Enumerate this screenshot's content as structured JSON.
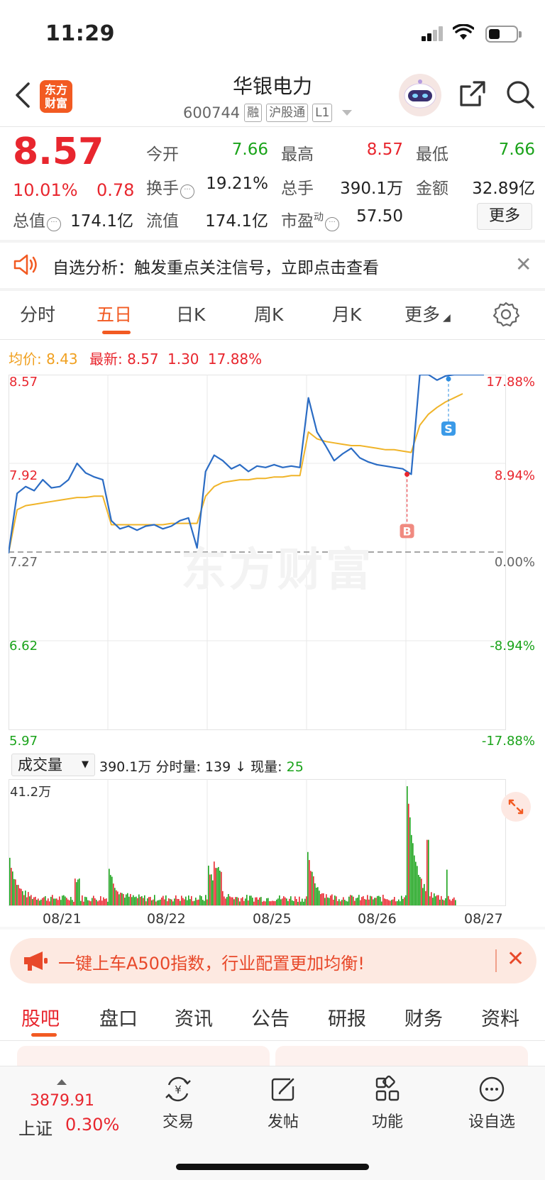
{
  "status_bar": {
    "time": "11:29"
  },
  "header": {
    "logo_line1": "东方",
    "logo_line2": "财富",
    "stock_name": "华银电力",
    "stock_code": "600744",
    "tags": [
      "融",
      "沪股通",
      "L1"
    ]
  },
  "quote": {
    "price": "8.57",
    "change_pct": "10.01%",
    "change": "0.78",
    "open_label": "今开",
    "open": "7.66",
    "high_label": "最高",
    "high": "8.57",
    "low_label": "最低",
    "low": "7.66",
    "turnover_label": "换手",
    "turnover": "19.21%",
    "volume_label": "总手",
    "volume": "390.1万",
    "amount_label": "金额",
    "amount": "32.89亿",
    "mktcap_label": "总值",
    "mktcap": "174.1亿",
    "float_label": "流值",
    "float": "174.1亿",
    "pe_label": "市盈",
    "pe_sup": "动",
    "pe": "57.50",
    "more_label": "更多"
  },
  "alert": {
    "text": "自选分析：触发重点关注信号，立即点击查看"
  },
  "chart_tabs": [
    "分时",
    "五日",
    "日K",
    "周K",
    "月K",
    "更多"
  ],
  "chart_tabs_active": 1,
  "legend": {
    "avg_label": "均价:",
    "avg": "8.43",
    "latest_label": "最新:",
    "latest": "8.57",
    "chg": "1.30",
    "pct": "17.88%"
  },
  "colors": {
    "up": "#e8262e",
    "down": "#1aa31a",
    "price_line": "#2b6cc4",
    "avg_line": "#f0b429",
    "brand": "#f25a22"
  },
  "chart_data": {
    "type": "line",
    "x": [
      "08/21",
      "08/22",
      "08/25",
      "08/26",
      "08/27"
    ],
    "y_ticks_left": [
      "8.57",
      "7.92",
      "7.27",
      "6.62",
      "5.97"
    ],
    "y_ticks_right": [
      "17.88%",
      "8.94%",
      "0.00%",
      "-8.94%",
      "-17.88%"
    ],
    "prev_close": 7.27,
    "ylim": [
      5.97,
      8.57
    ],
    "series": [
      {
        "values": [
          7.26,
          7.7,
          7.75,
          7.72,
          7.8,
          7.74,
          7.75,
          7.8,
          7.92,
          7.85,
          7.82,
          7.8,
          7.5,
          7.44,
          7.46,
          7.43,
          7.46,
          7.47,
          7.44,
          7.46,
          7.5,
          7.52,
          7.3,
          7.86,
          7.98,
          7.94,
          7.88,
          7.91,
          7.86,
          7.9,
          7.89,
          7.91,
          7.89,
          7.9,
          7.89,
          8.4,
          8.15,
          8.05,
          7.94,
          7.99,
          8.03,
          7.96,
          7.93,
          7.91,
          7.9,
          7.89,
          7.88,
          7.84,
          8.57,
          8.57,
          8.53,
          8.56,
          8.57,
          8.57
        ]
      },
      {
        "values": [
          7.26,
          7.58,
          7.61,
          7.62,
          7.63,
          7.64,
          7.65,
          7.66,
          7.67,
          7.67,
          7.68,
          7.68,
          7.47,
          7.47,
          7.47,
          7.47,
          7.47,
          7.47,
          7.47,
          7.48,
          7.48,
          7.48,
          7.48,
          7.68,
          7.75,
          7.78,
          7.79,
          7.8,
          7.8,
          7.81,
          7.81,
          7.82,
          7.82,
          7.83,
          7.83,
          8.15,
          8.1,
          8.08,
          8.07,
          8.06,
          8.05,
          8.05,
          8.04,
          8.03,
          8.02,
          8.02,
          8.01,
          8.0,
          8.2,
          8.28,
          8.33,
          8.37,
          8.4,
          8.43
        ]
      }
    ],
    "markers": [
      {
        "label": "B"
      },
      {
        "label": "S"
      }
    ]
  },
  "volume": {
    "select_label": "成交量",
    "total": "390.1万",
    "info_mid": "分时量: 139 ↓ 现量:",
    "now": "25",
    "max_label": "41.2万"
  },
  "banner": {
    "text": "一键上车A500指数，行业配置更加均衡!"
  },
  "bottom_tabs": [
    "股吧",
    "盘口",
    "资讯",
    "公告",
    "研报",
    "财务",
    "资料"
  ],
  "bottom_nav": {
    "index_value": "3879.91",
    "index_name": "上证",
    "index_pct": "0.30%",
    "items": [
      "交易",
      "发帖",
      "功能",
      "设自选"
    ]
  }
}
